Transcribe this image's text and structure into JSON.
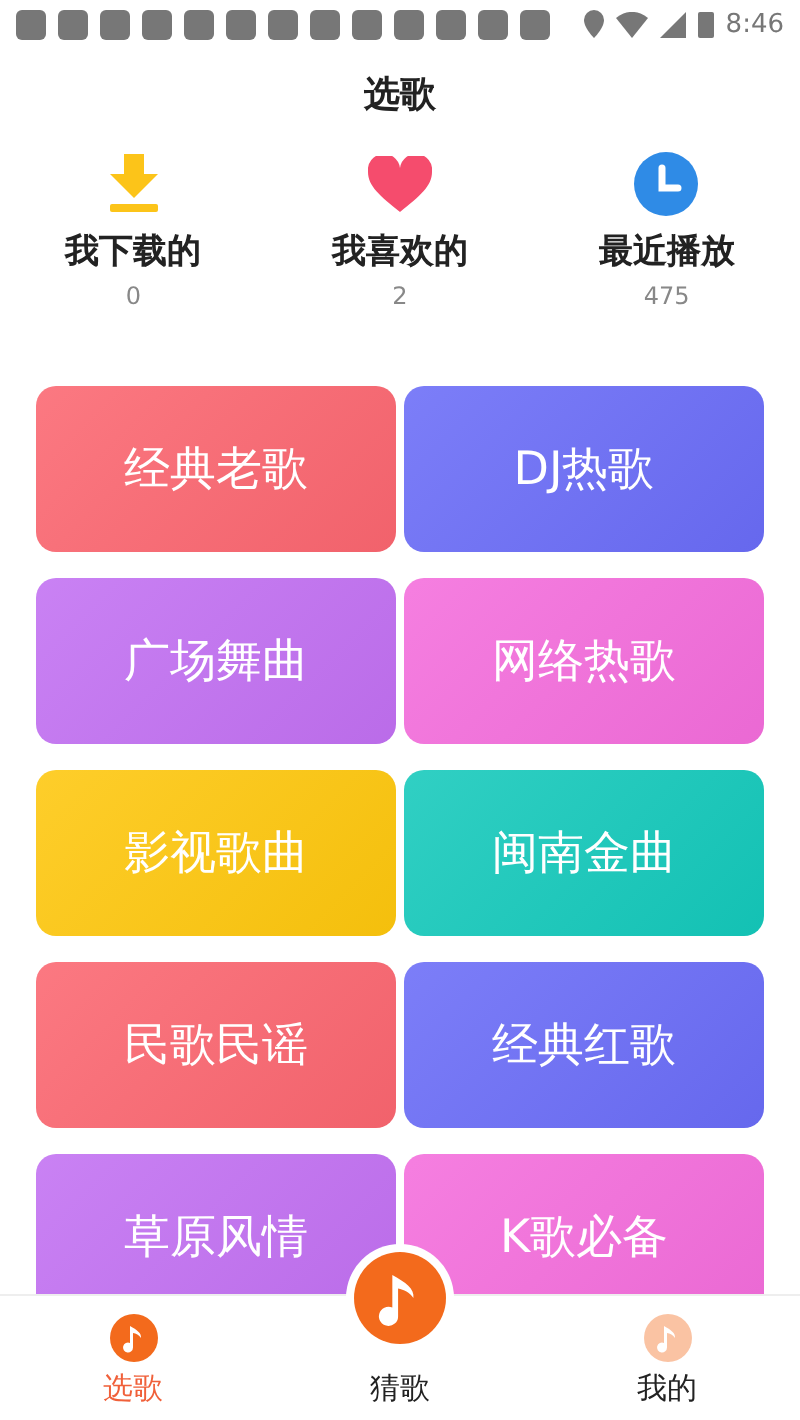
{
  "status_bar": {
    "time": "8:46"
  },
  "title": "选歌",
  "stats": [
    {
      "kind": "download",
      "label": "我下载的",
      "count": "0"
    },
    {
      "kind": "favorite",
      "label": "我喜欢的",
      "count": "2"
    },
    {
      "kind": "recent",
      "label": "最近播放",
      "count": "475"
    }
  ],
  "categories": [
    {
      "label": "经典老歌",
      "color": "#fb6670"
    },
    {
      "label": "DJ热歌",
      "color": "#6a6cf7"
    },
    {
      "label": "广场舞曲",
      "color": "#c270f2"
    },
    {
      "label": "网络热歌",
      "color": "#f46ddc"
    },
    {
      "label": "影视歌曲",
      "color": "#fec70d"
    },
    {
      "label": "闽南金曲",
      "color": "#14c9bb"
    },
    {
      "label": "民歌民谣",
      "color": "#fb6670"
    },
    {
      "label": "经典红歌",
      "color": "#6a6cf7"
    },
    {
      "label": "草原风情",
      "color": "#c270f2"
    },
    {
      "label": "K歌必备",
      "color": "#f46ddc"
    }
  ],
  "nav": [
    {
      "kind": "tab",
      "label": "选歌",
      "selected": true
    },
    {
      "kind": "center",
      "label": "猜歌",
      "selected": false
    },
    {
      "kind": "tab",
      "label": "我的",
      "selected": false
    }
  ]
}
